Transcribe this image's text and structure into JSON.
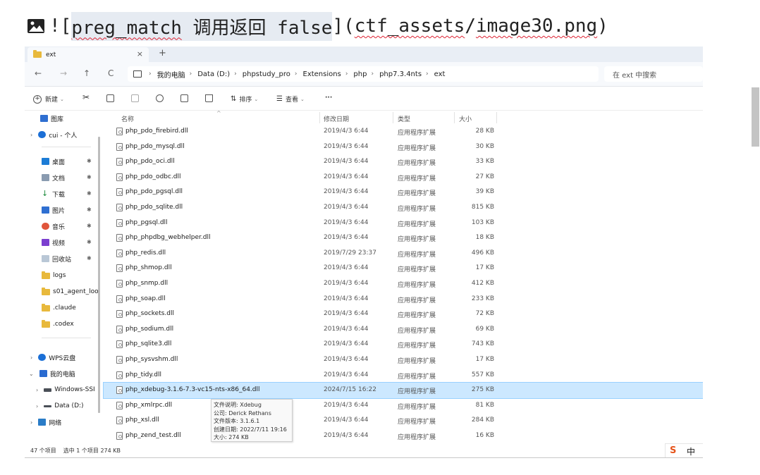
{
  "markdown_line": {
    "prefix": "![",
    "link_text_code": "preg_match",
    "link_text_cn": " 调用返回 ",
    "link_text_tail": "false",
    "mid": "](",
    "path_a": "ctf_assets",
    "slash": "/",
    "path_b": "image30.png",
    "suffix": ")"
  },
  "window": {
    "tab_title": "ext",
    "tab_close": "×",
    "tab_add": "+",
    "nav": {
      "back": "←",
      "forward": "→",
      "up": "↑",
      "refresh": "C"
    },
    "breadcrumbs": [
      "我的电脑",
      "Data (D:)",
      "phpstudy_pro",
      "Extensions",
      "php",
      "php7.3.4nts",
      "ext"
    ],
    "breadcrumb_sep": "›",
    "search_placeholder": "在 ext 中搜索",
    "toolbar": {
      "new_label": "新建",
      "sort_label": "排序",
      "view_label": "查看",
      "more_label": "···"
    },
    "sidebar": {
      "gallery": "图库",
      "cloud": "cui - 个人",
      "quick": [
        "桌面",
        "文档",
        "下载",
        "图片",
        "音乐",
        "视频",
        "回收站"
      ],
      "folders": [
        "logs",
        "s01_agent_loo",
        ".claude",
        ".codex"
      ],
      "wps": "WPS云盘",
      "this_pc": "我的电脑",
      "windows": "Windows-SSI",
      "data_drive": "Data (D:)",
      "network": "网络"
    },
    "columns": {
      "name": "名称",
      "date": "修改日期",
      "type": "类型",
      "size": "大小"
    },
    "files": [
      {
        "name": "php_pdo_firebird.dll",
        "date": "2019/4/3 6:44",
        "type": "应用程序扩展",
        "size": "28 KB"
      },
      {
        "name": "php_pdo_mysql.dll",
        "date": "2019/4/3 6:44",
        "type": "应用程序扩展",
        "size": "30 KB"
      },
      {
        "name": "php_pdo_oci.dll",
        "date": "2019/4/3 6:44",
        "type": "应用程序扩展",
        "size": "33 KB"
      },
      {
        "name": "php_pdo_odbc.dll",
        "date": "2019/4/3 6:44",
        "type": "应用程序扩展",
        "size": "27 KB"
      },
      {
        "name": "php_pdo_pgsql.dll",
        "date": "2019/4/3 6:44",
        "type": "应用程序扩展",
        "size": "39 KB"
      },
      {
        "name": "php_pdo_sqlite.dll",
        "date": "2019/4/3 6:44",
        "type": "应用程序扩展",
        "size": "815 KB"
      },
      {
        "name": "php_pgsql.dll",
        "date": "2019/4/3 6:44",
        "type": "应用程序扩展",
        "size": "103 KB"
      },
      {
        "name": "php_phpdbg_webhelper.dll",
        "date": "2019/4/3 6:44",
        "type": "应用程序扩展",
        "size": "18 KB"
      },
      {
        "name": "php_redis.dll",
        "date": "2019/7/29 23:37",
        "type": "应用程序扩展",
        "size": "496 KB"
      },
      {
        "name": "php_shmop.dll",
        "date": "2019/4/3 6:44",
        "type": "应用程序扩展",
        "size": "17 KB"
      },
      {
        "name": "php_snmp.dll",
        "date": "2019/4/3 6:44",
        "type": "应用程序扩展",
        "size": "412 KB"
      },
      {
        "name": "php_soap.dll",
        "date": "2019/4/3 6:44",
        "type": "应用程序扩展",
        "size": "233 KB"
      },
      {
        "name": "php_sockets.dll",
        "date": "2019/4/3 6:44",
        "type": "应用程序扩展",
        "size": "72 KB"
      },
      {
        "name": "php_sodium.dll",
        "date": "2019/4/3 6:44",
        "type": "应用程序扩展",
        "size": "69 KB"
      },
      {
        "name": "php_sqlite3.dll",
        "date": "2019/4/3 6:44",
        "type": "应用程序扩展",
        "size": "743 KB"
      },
      {
        "name": "php_sysvshm.dll",
        "date": "2019/4/3 6:44",
        "type": "应用程序扩展",
        "size": "17 KB"
      },
      {
        "name": "php_tidy.dll",
        "date": "2019/4/3 6:44",
        "type": "应用程序扩展",
        "size": "557 KB"
      },
      {
        "name": "php_xdebug-3.1.6-7.3-vc15-nts-x86_64.dll",
        "date": "2024/7/15 16:22",
        "type": "应用程序扩展",
        "size": "275 KB",
        "selected": true
      },
      {
        "name": "php_xmlrpc.dll",
        "date": "2019/4/3 6:44",
        "type": "应用程序扩展",
        "size": "81 KB"
      },
      {
        "name": "php_xsl.dll",
        "date": "2019/4/3 6:44",
        "type": "应用程序扩展",
        "size": "284 KB"
      },
      {
        "name": "php_zend_test.dll",
        "date": "2019/4/3 6:44",
        "type": "应用程序扩展",
        "size": "16 KB"
      }
    ],
    "tooltip": {
      "line1": "文件说明: Xdebug",
      "line2": "公司: Derick Rethans",
      "line3": "文件版本: 3.1.6.1",
      "line4": "创建日期: 2022/7/11 19:16",
      "line5": "大小: 274 KB"
    },
    "status": {
      "count": "47 个项目",
      "selection": "选中 1 个项目 274 KB"
    },
    "ime": {
      "logo": "S",
      "mode": "中"
    }
  },
  "colors": {
    "selection_bg": "#cce8ff",
    "selection_border": "#99d1ff",
    "folder": "#e8b93c",
    "ime_logo": "#e6541b"
  }
}
